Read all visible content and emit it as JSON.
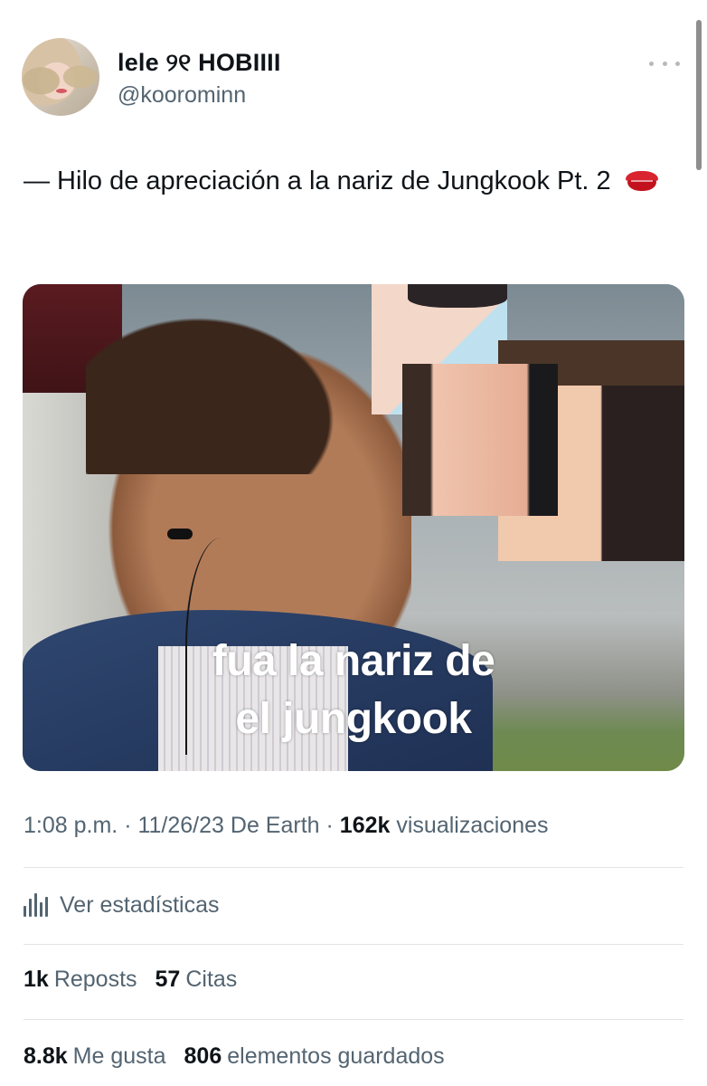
{
  "user": {
    "display_name": "lele ୨୧ HOBIIII",
    "handle": "@koorominn"
  },
  "tweet": {
    "text": "— Hilo de apreciación a la nariz de Jungkook Pt. 2",
    "emoji": "kiss-mark-icon"
  },
  "media": {
    "caption_line1": "fua la nariz de",
    "caption_line2": "el jungkook"
  },
  "meta": {
    "time": "1:08 p.m.",
    "date": "11/26/23",
    "source": "De Earth",
    "views_count": "162k",
    "views_label": "visualizaciones"
  },
  "stats_link": {
    "label": "Ver estadísticas",
    "icon": "analytics-icon"
  },
  "engagement": {
    "reposts_count": "1k",
    "reposts_label": "Reposts",
    "quotes_count": "57",
    "quotes_label": "Citas",
    "likes_count": "8.8k",
    "likes_label": "Me gusta",
    "bookmarks_count": "806",
    "bookmarks_label": "elementos guardados"
  },
  "colors": {
    "text_primary": "#0f1419",
    "text_secondary": "#536471",
    "divider": "#e1e5e8"
  }
}
